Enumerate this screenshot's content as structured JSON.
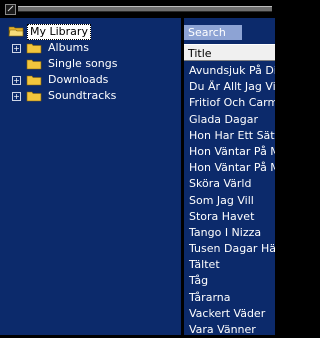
{
  "library": {
    "root_label": "My Library",
    "folders": [
      {
        "label": "Albums",
        "expandable": true
      },
      {
        "label": "Single songs",
        "expandable": false
      },
      {
        "label": "Downloads",
        "expandable": true
      },
      {
        "label": "Soundtracks",
        "expandable": true
      }
    ]
  },
  "search": {
    "tab_label": "Search",
    "column_header": "Title",
    "rows": [
      "Avundsjuk På Dig",
      "Du Är Allt Jag Vill H",
      "Fritiof Och Carmen",
      "Glada Dagar",
      "Hon Har Ett Sätt",
      "Hon Väntar På Mig",
      "Hon Väntar På Mig",
      "Sköra Värld",
      "Som Jag Vill",
      "Stora Havet",
      "Tango I Nizza",
      "Tusen Dagar Härif",
      "Tältet",
      "Tåg",
      "Tårarna",
      "Vackert Väder",
      "Vara Vänner"
    ]
  },
  "icons": {
    "expander": "plus-expander-icon",
    "folder": "folder-icon",
    "open_folder": "open-folder-icon",
    "resize": "resize-handle-icon"
  },
  "colors": {
    "pane_background": "#0c2a6b",
    "tab_background": "#8da3d4",
    "folder_yellow": "#f2c53d"
  }
}
